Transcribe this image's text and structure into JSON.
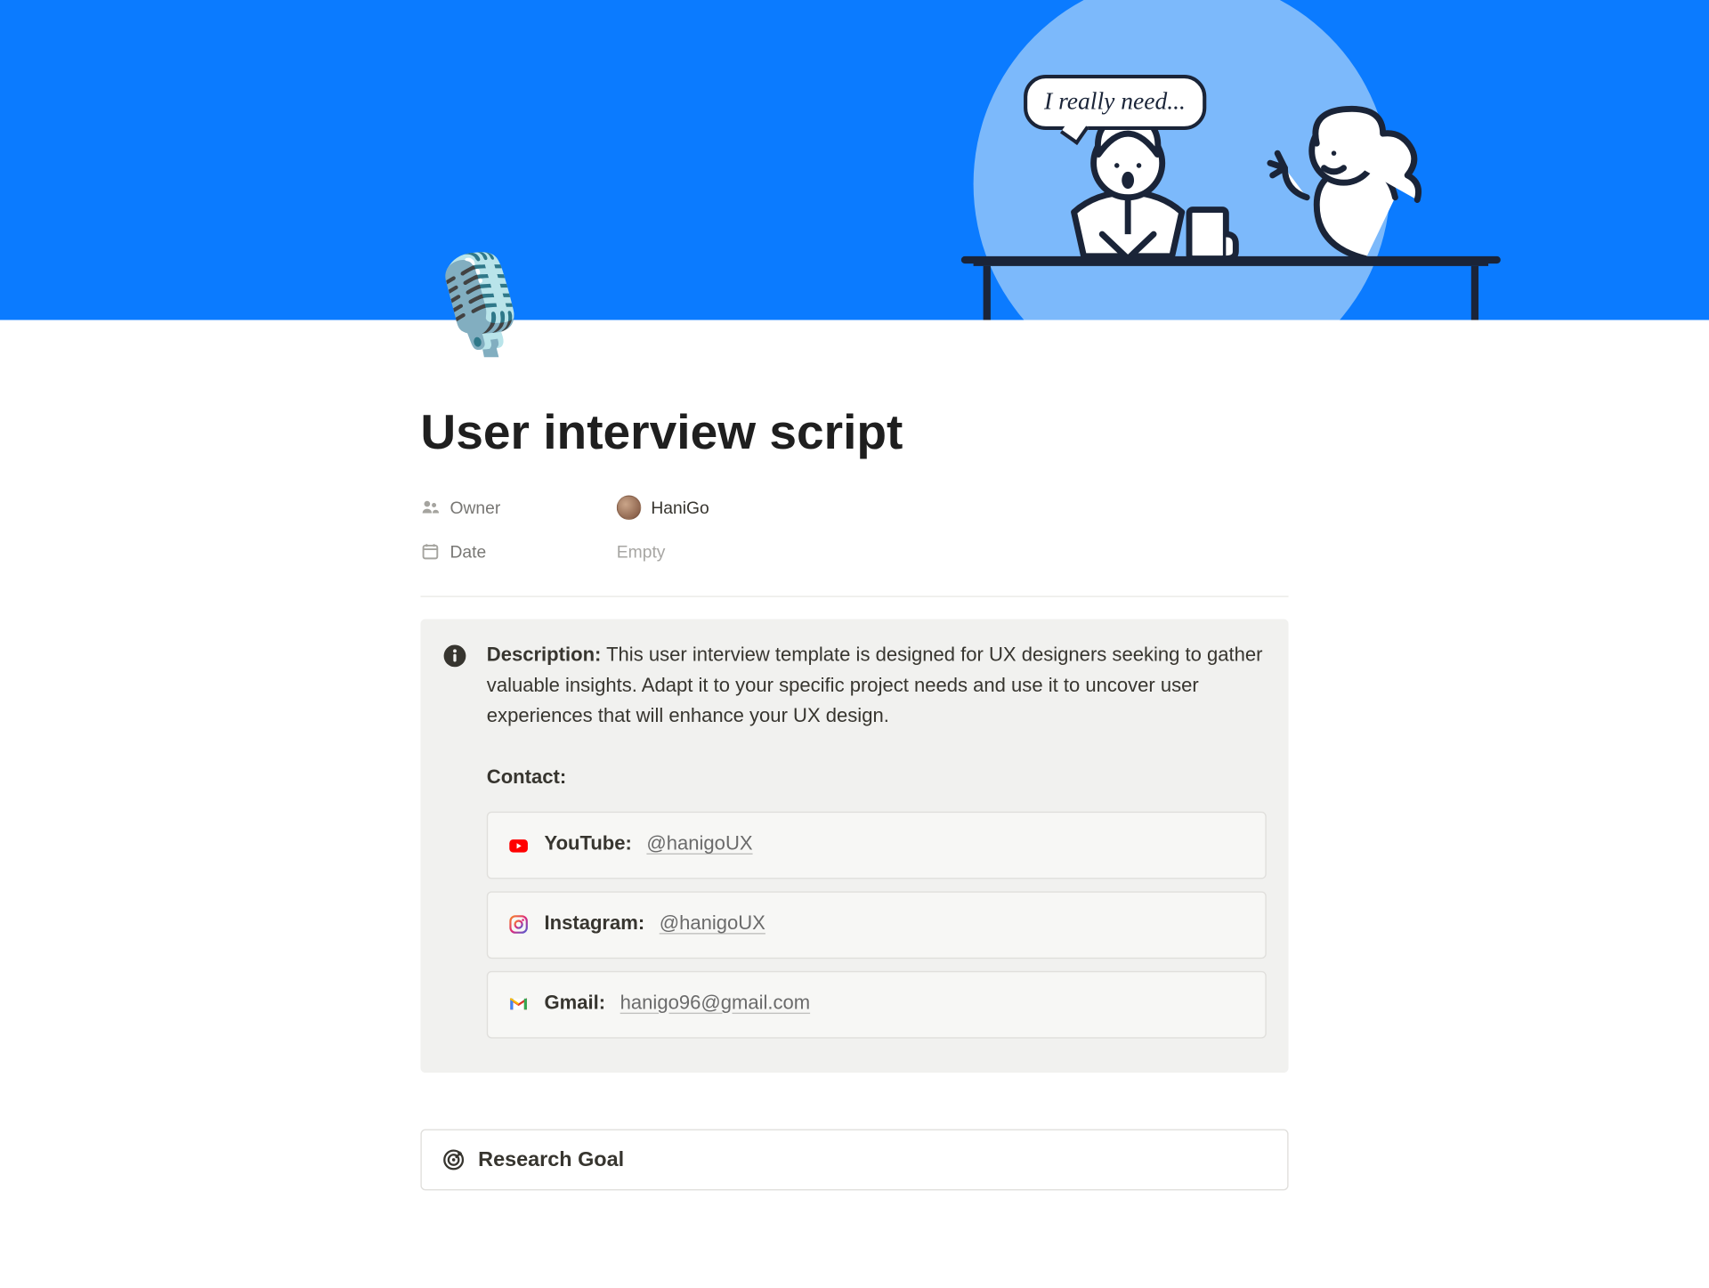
{
  "cover": {
    "speech": "I really need..."
  },
  "page": {
    "icon_name": "studio-microphone-emoji",
    "title": "User interview script"
  },
  "properties": {
    "owner": {
      "label": "Owner",
      "value": "HaniGo"
    },
    "date": {
      "label": "Date",
      "value": "Empty"
    }
  },
  "description": {
    "label": "Description:",
    "text": "This user interview template is designed for UX designers seeking to gather valuable insights. Adapt it to your specific project needs and use it to uncover user experiences that will enhance your UX design."
  },
  "contact": {
    "heading": "Contact:",
    "youtube": {
      "label": "YouTube:",
      "handle": "@hanigoUX"
    },
    "instagram": {
      "label": "Instagram:",
      "handle": "@hanigoUX"
    },
    "gmail": {
      "label": "Gmail:",
      "handle": "hanigo96@gmail.com"
    }
  },
  "sections": {
    "research_goal": {
      "title": "Research Goal"
    }
  }
}
